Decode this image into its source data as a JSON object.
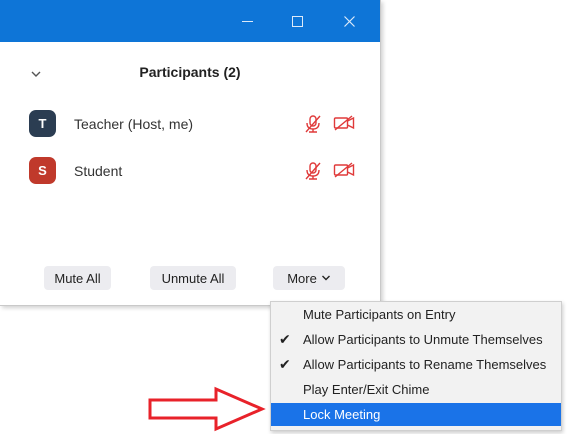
{
  "window": {
    "title_buttons": [
      "minimize-icon",
      "maximize-icon",
      "close-icon"
    ],
    "accent": "#0e75d7"
  },
  "panel": {
    "title": "Participants (2)",
    "collapse_icon": "chevron-down-icon"
  },
  "participants": [
    {
      "initial": "T",
      "name": "Teacher (Host, me)",
      "avatar_color": "#2b3d52",
      "mic": "muted",
      "video": "off"
    },
    {
      "initial": "S",
      "name": "Student",
      "avatar_color": "#c0392b",
      "mic": "muted",
      "video": "off"
    }
  ],
  "status_colors": {
    "muted_icon": "#e03a3a"
  },
  "actions": {
    "mute_all": "Mute All",
    "unmute_all": "Unmute All",
    "more": "More"
  },
  "more_menu": {
    "items": [
      {
        "label": "Mute Participants on Entry",
        "checked": false,
        "check_mark": ""
      },
      {
        "label": "Allow Participants to Unmute Themselves",
        "checked": true,
        "check_mark": "✔"
      },
      {
        "label": "Allow Participants to Rename Themselves",
        "checked": true,
        "check_mark": "✔"
      },
      {
        "label": "Play Enter/Exit Chime",
        "checked": false,
        "check_mark": ""
      },
      {
        "label": "Lock Meeting",
        "checked": false,
        "check_mark": "",
        "highlighted": true
      }
    ],
    "highlight_color": "#1a73e8"
  },
  "annotation": {
    "icon": "red-arrow-icon",
    "color": "#e8222a"
  }
}
